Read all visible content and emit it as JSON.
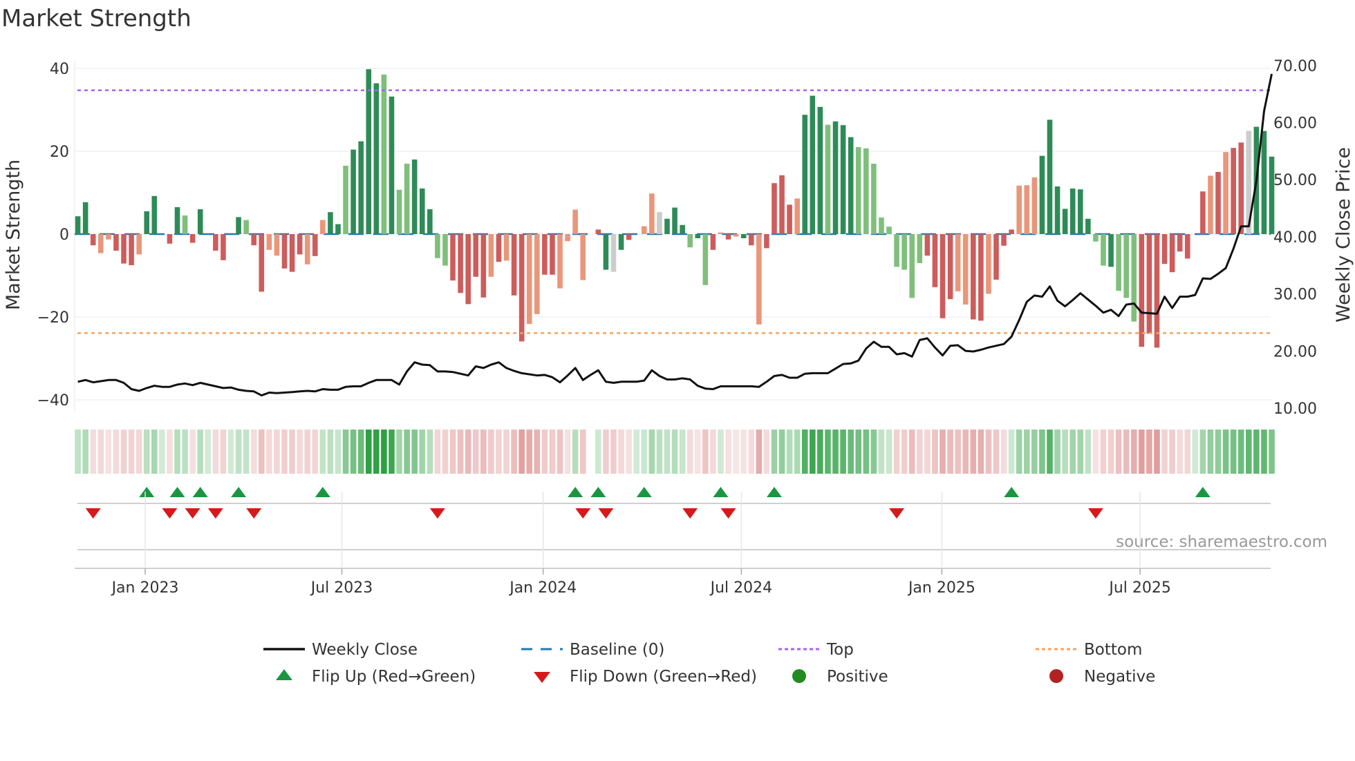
{
  "chart_data": {
    "type": "bar",
    "title": "Market Strength",
    "ylabel": "Market Strength",
    "y2label": "Weekly Close Price",
    "ylim": [
      -42,
      40
    ],
    "y2lim": [
      10,
      70
    ],
    "yticks": [
      "40",
      "20",
      "0",
      "−20",
      "−40"
    ],
    "ytick_values": [
      40,
      20,
      0,
      -20,
      -40
    ],
    "y2ticks": [
      "70.00",
      "60.00",
      "50.00",
      "40.00",
      "30.00",
      "20.00",
      "10.00"
    ],
    "y2tick_values": [
      70,
      60,
      50,
      40,
      30,
      20,
      10
    ],
    "top_level": 34.7,
    "bottom_level": -23.9,
    "xticks": [
      {
        "label": "Jan 2023",
        "week": 8.8
      },
      {
        "label": "Jul 2023",
        "week": 34.5
      },
      {
        "label": "Jan 2024",
        "week": 60.8
      },
      {
        "label": "Jul 2024",
        "week": 86.7
      },
      {
        "label": "Jan 2025",
        "week": 112.9
      },
      {
        "label": "Jul 2025",
        "week": 138.8
      }
    ],
    "strength": [
      4.3,
      7.7,
      -2.7,
      -4.6,
      -1.3,
      -4,
      -7.1,
      -7.5,
      -4.9,
      5.5,
      9.2,
      0,
      -2.3,
      6.5,
      4.5,
      -2.1,
      6,
      0,
      -4,
      -6.3,
      0,
      4.1,
      3.4,
      -2.7,
      -13.9,
      -3.8,
      -5.2,
      -8.3,
      -9.1,
      -4.9,
      -7.3,
      -5.3,
      3.4,
      5.3,
      2.4,
      16.5,
      20.4,
      22.4,
      39.8,
      36.4,
      38.5,
      33.2,
      10.7,
      17,
      18,
      11,
      6,
      -5.8,
      -7.6,
      -11.2,
      -14.2,
      -16.9,
      -10.3,
      -15.3,
      -10.3,
      -6.7,
      -6.4,
      -14.8,
      -25.9,
      -21.7,
      -19.3,
      -9.8,
      -9.8,
      -13.1,
      -1.7,
      5.9,
      -11.1,
      0,
      1.1,
      -8.6,
      -9.1,
      -3.8,
      -1.4,
      0,
      1.9,
      9.8,
      5.3,
      3.7,
      6.4,
      2.2,
      -3.2,
      -1,
      -12.3,
      -3.8,
      0.4,
      -1.3,
      -0.6,
      -1,
      -2.7,
      -21.8,
      -3.4,
      12.3,
      14.2,
      7.1,
      8.6,
      28.8,
      33.4,
      30.7,
      26.4,
      27.2,
      26.3,
      23.4,
      21,
      20.7,
      17,
      4,
      1.8,
      -7.9,
      -8.6,
      -15.4,
      -7,
      -5.2,
      -12.8,
      -20.3,
      -15.7,
      -13.8,
      -17,
      -20.6,
      -20.9,
      -14.4,
      -11,
      -2.8,
      1.1,
      11.7,
      11.8,
      13.7,
      18.9,
      27.6,
      11.5,
      6.1,
      11,
      10.8,
      3.7,
      -1.8,
      -7.6,
      -7.9,
      -13.7,
      -15.4,
      -21.1,
      -27.2,
      -24,
      -27.4,
      -7.2,
      -9.2,
      -4.2,
      -5.9,
      0,
      10.3,
      14.1,
      15,
      19.8,
      20.8,
      22.1,
      24.9,
      25.9,
      24.9,
      18.7
    ],
    "strength_shade": "ddroorrroddxrdlrdxrrxdlrroorrroroddlddddldlldddllrrrrrororroorroooorrdxdrrooxdddldlrorodrorrrrodddldddlllllllllrrrroorrorrrooodddddddlldlllrrrrrrrorororrxdddddddddl",
    "weekly_close": [
      14.5,
      14.8,
      14.4,
      14.6,
      14.8,
      14.8,
      14.3,
      13.2,
      12.9,
      13.4,
      13.8,
      13.6,
      13.6,
      14,
      14.2,
      13.9,
      14.3,
      14,
      13.7,
      13.4,
      13.5,
      13.1,
      12.9,
      12.8,
      12.1,
      12.6,
      12.5,
      12.6,
      12.7,
      12.8,
      12.9,
      12.8,
      13.2,
      13.1,
      13.1,
      13.6,
      13.7,
      13.7,
      14.3,
      14.8,
      14.8,
      14.8,
      14,
      16.3,
      17.9,
      17.5,
      17.4,
      16.3,
      16.3,
      16.2,
      15.9,
      15.6,
      17.2,
      16.9,
      17.5,
      17.9,
      16.9,
      16.4,
      16,
      15.8,
      15.6,
      15.7,
      15.3,
      14.4,
      15.6,
      16.9,
      14.8,
      15.7,
      16.5,
      14.5,
      14.3,
      14.5,
      14.5,
      14.5,
      14.7,
      16.5,
      15.5,
      14.9,
      14.9,
      15.1,
      14.9,
      13.8,
      13.3,
      13.2,
      13.7,
      13.7,
      13.7,
      13.7,
      13.7,
      13.6,
      14.5,
      15.5,
      15.7,
      15.2,
      15.2,
      15.9,
      16,
      16,
      16,
      16.8,
      17.6,
      17.7,
      18.2,
      20.3,
      21.5,
      20.6,
      20.6,
      19.3,
      19.5,
      18.9,
      21.8,
      22.1,
      20.5,
      19.1,
      20.8,
      20.9,
      19.9,
      19.8,
      20.1,
      20.5,
      20.8,
      21.1,
      22.4,
      25.3,
      28.5,
      29.6,
      29.4,
      31.2,
      28.7,
      27.7,
      28.8,
      30,
      28.9,
      27.8,
      26.6,
      27.1,
      26,
      28,
      28.2,
      26.6,
      26.5,
      26.4,
      29.4,
      27.4,
      29.4,
      29.4,
      29.7,
      32.6,
      32.5,
      33.4,
      34.4,
      37.8,
      41.7,
      41.7,
      49.7,
      61.9,
      68.4
    ],
    "flip_up_weeks": [
      10,
      14,
      17,
      22,
      33,
      66,
      69,
      75,
      85,
      92,
      123,
      148
    ],
    "flip_down_weeks": [
      3,
      13,
      16,
      19,
      24,
      48,
      67,
      70,
      81,
      86,
      108,
      134
    ],
    "legend": [
      {
        "label": "Weekly Close",
        "kind": "line",
        "color": "#111111"
      },
      {
        "label": "Baseline (0)",
        "kind": "dash",
        "color": "#1f77b4"
      },
      {
        "label": "Top",
        "kind": "dot",
        "color": "#a463f2"
      },
      {
        "label": "Bottom",
        "kind": "dot",
        "color": "#f4a261"
      },
      {
        "label": "Flip Up (Red→Green)",
        "kind": "up",
        "color": "#1a9641"
      },
      {
        "label": "Flip Down (Green→Red)",
        "kind": "down",
        "color": "#d7191c"
      },
      {
        "label": "Positive",
        "kind": "circle",
        "color": "#228b22"
      },
      {
        "label": "Negative",
        "kind": "circle",
        "color": "#b22222"
      }
    ],
    "legend_position": "bottom",
    "source": "source: sharemaestro.com",
    "colors": {
      "dark_green": "#2e8b57",
      "light_green": "#7fbf7b",
      "red": "#cd5c5c",
      "orange": "#e9967a",
      "top": "#a463f2",
      "bottom": "#f4a261",
      "baseline": "#1f77b4"
    }
  }
}
